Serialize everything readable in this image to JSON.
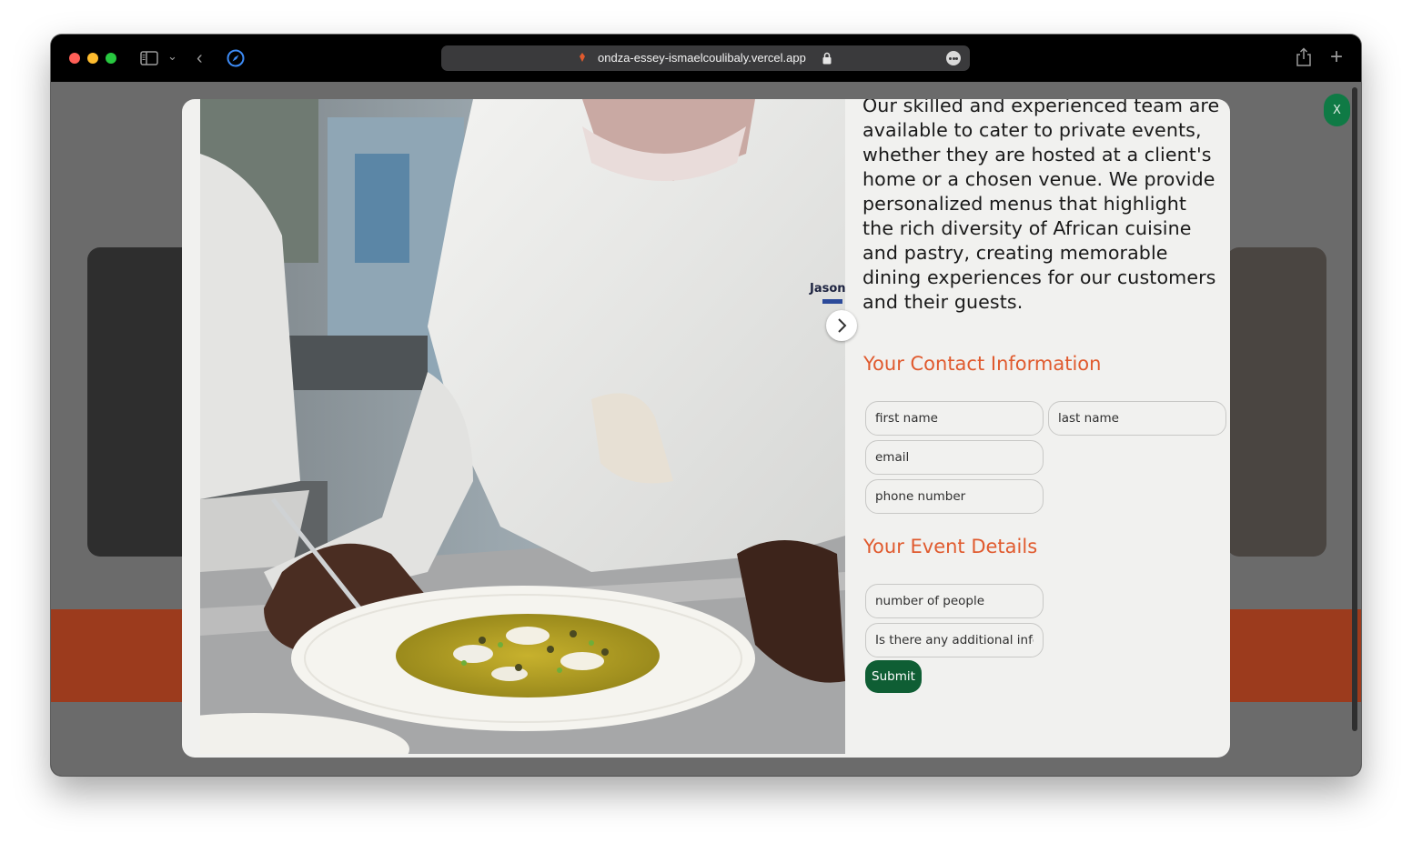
{
  "browser": {
    "url": "ondza-essey-ismaelcoulibaly.vercel.app",
    "icons": [
      "sidebar-icon",
      "chevron-down-icon",
      "back-icon",
      "compass-icon",
      "lock-icon",
      "more-icon",
      "share-icon",
      "new-tab-icon"
    ]
  },
  "modal": {
    "close_label": "X",
    "description": "Our skilled and experienced team are available to cater to private events, whether they are hosted at a client's home or a chosen venue. We provide personalized menus that highlight the rich diversity of African cuisine and pastry, creating memorable dining experiences for our customers and their guests.",
    "contact_section_title": "Your Contact Information",
    "event_section_title": "Your Event Details",
    "fields": {
      "first_name_placeholder": "first name",
      "last_name_placeholder": "last name",
      "email_placeholder": "email",
      "phone_placeholder": "phone number",
      "people_placeholder": "number of people",
      "additional_info_placeholder": "Is there any additional infor"
    },
    "submit_label": "Submit",
    "image_embroidery_text": "Jason"
  },
  "colors": {
    "accent_orange": "#e05a2e",
    "button_green": "#0f5e34",
    "close_green": "#0f7a45",
    "modal_background": "#f1f1ef"
  }
}
